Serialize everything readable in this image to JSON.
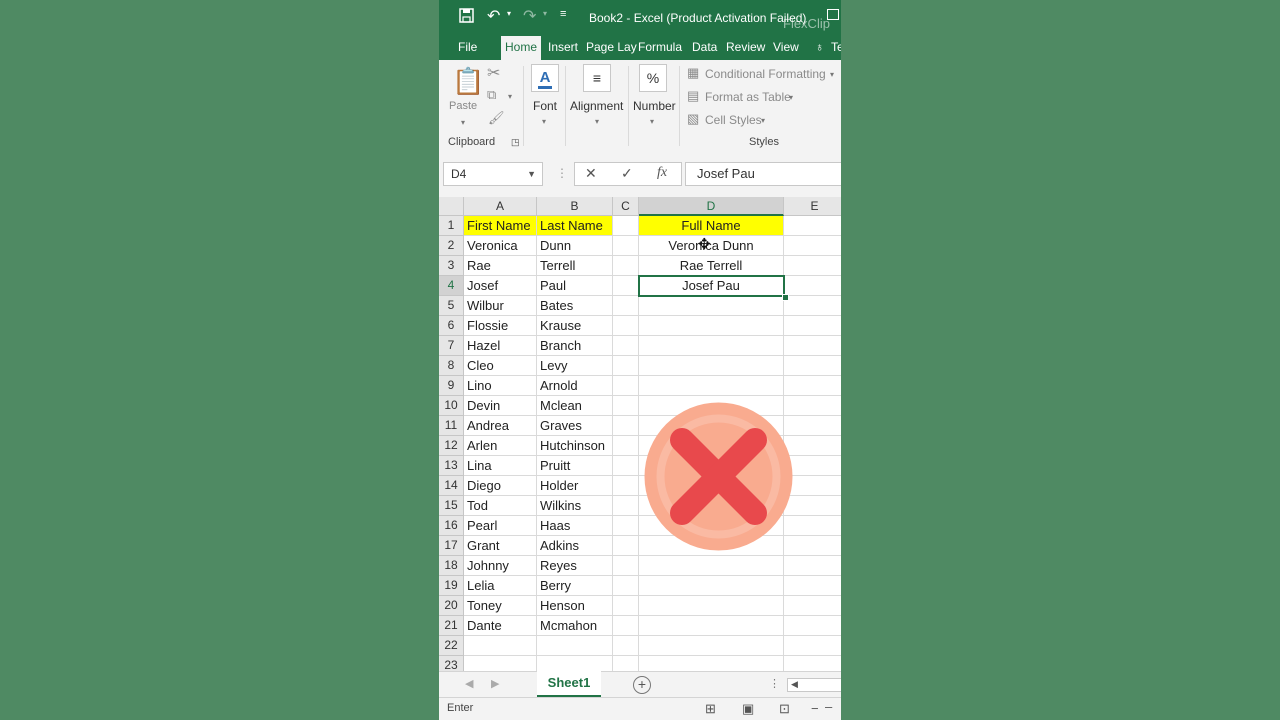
{
  "titlebar": {
    "title": "Book2 - Excel (Product Activation Failed)",
    "watermark": "FlexClip"
  },
  "tabs": [
    "File",
    "Home",
    "Insert",
    "Page Lay",
    "Formula",
    "Data",
    "Review",
    "View",
    "Te"
  ],
  "active_tab": "Home",
  "ribbon": {
    "paste_label": "Paste",
    "font_label": "Font",
    "alignment_label": "Alignment",
    "number_label": "Number",
    "conditional_formatting": "Conditional Formatting",
    "format_as_table": "Format as Table",
    "cell_styles": "Cell Styles",
    "clipboard_group": "Clipboard",
    "styles_group": "Styles"
  },
  "formula_bar": {
    "name_box": "D4",
    "cancel_symbol": "✕",
    "enter_symbol": "✓",
    "fx_symbol": "fx",
    "value": "Josef Pau"
  },
  "sheet": {
    "columns": [
      "A",
      "B",
      "C",
      "D",
      "E"
    ],
    "rows": [
      {
        "n": "1",
        "a": "First Name",
        "b": "Last Name",
        "d": "Full Name"
      },
      {
        "n": "2",
        "a": "Veronica",
        "b": "Dunn",
        "d": "Veronica Dunn"
      },
      {
        "n": "3",
        "a": "Rae",
        "b": "Terrell",
        "d": "Rae Terrell"
      },
      {
        "n": "4",
        "a": "Josef",
        "b": "Paul",
        "d": "Josef Pau"
      },
      {
        "n": "5",
        "a": "Wilbur",
        "b": "Bates",
        "d": ""
      },
      {
        "n": "6",
        "a": "Flossie",
        "b": "Krause",
        "d": ""
      },
      {
        "n": "7",
        "a": "Hazel",
        "b": "Branch",
        "d": ""
      },
      {
        "n": "8",
        "a": "Cleo",
        "b": "Levy",
        "d": ""
      },
      {
        "n": "9",
        "a": "Lino",
        "b": "Arnold",
        "d": ""
      },
      {
        "n": "10",
        "a": "Devin",
        "b": "Mclean",
        "d": ""
      },
      {
        "n": "11",
        "a": "Andrea",
        "b": "Graves",
        "d": ""
      },
      {
        "n": "12",
        "a": "Arlen",
        "b": "Hutchinson",
        "d": ""
      },
      {
        "n": "13",
        "a": "Lina",
        "b": "Pruitt",
        "d": ""
      },
      {
        "n": "14",
        "a": "Diego",
        "b": "Holder",
        "d": ""
      },
      {
        "n": "15",
        "a": "Tod",
        "b": "Wilkins",
        "d": ""
      },
      {
        "n": "16",
        "a": "Pearl",
        "b": "Haas",
        "d": ""
      },
      {
        "n": "17",
        "a": "Grant",
        "b": "Adkins",
        "d": ""
      },
      {
        "n": "18",
        "a": "Johnny",
        "b": "Reyes",
        "d": ""
      },
      {
        "n": "19",
        "a": "Lelia",
        "b": "Berry",
        "d": ""
      },
      {
        "n": "20",
        "a": "Toney",
        "b": "Henson",
        "d": ""
      },
      {
        "n": "21",
        "a": "Dante",
        "b": "Mcmahon",
        "d": ""
      },
      {
        "n": "22",
        "a": "",
        "b": "",
        "d": ""
      },
      {
        "n": "23",
        "a": "",
        "b": "",
        "d": ""
      }
    ],
    "selected_cell": "D4",
    "header_highlight": "#ffff00"
  },
  "sheet_tabs": {
    "active": "Sheet1"
  },
  "status": {
    "mode": "Enter"
  },
  "colors": {
    "excel_green": "#217346",
    "error_red": "#e8494c",
    "error_circle": "#f9ab8f"
  },
  "overlay_icon": "error-x-icon"
}
